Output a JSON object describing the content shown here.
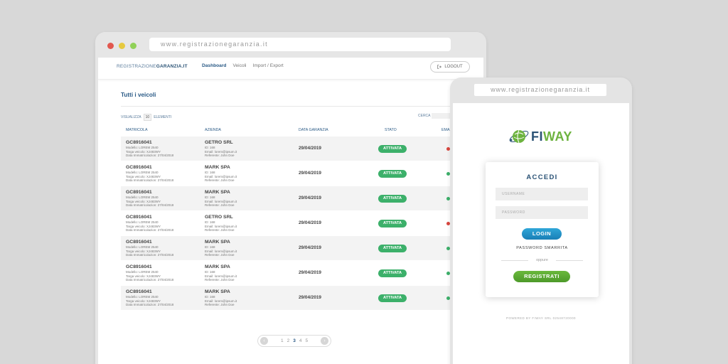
{
  "desktop": {
    "url": "www.registrazionegaranzia.it",
    "brand_light": "REGISTRAZIONE",
    "brand_bold": "GARANZIA.IT",
    "menu": [
      "Dashboard",
      "Veicoli",
      "Import / Export"
    ],
    "logout_label": "LOGOUT",
    "section_title": "Tutti i veicoli",
    "visualizza_label": "VISUALIZZA",
    "visualizza_value": "10",
    "elementi_label": "ELEMENTI",
    "cerca_label": "CERCA",
    "columns": [
      "MATRICOLA",
      "AZIENDA",
      "DATA GARANZIA",
      "STATO",
      "EMA"
    ],
    "rows": [
      {
        "code": "GC8916041",
        "modello": "Modello: LOREM 2540",
        "targa": "Targa veicolo: XJ483WY",
        "data_imm": "Data Immatricolazion: 27/04/2018",
        "azienda": "GETRO SRL",
        "id": "ID: 168",
        "email": "Email: lorem@ipsum.it",
        "referente": "Referente: John Doe",
        "data": "29/04/2019",
        "stato": "ATTIVATA",
        "ema": "red"
      },
      {
        "code": "GC8916041",
        "modello": "Modello: LOREM 2540",
        "targa": "Targa veicolo: XJ483WY",
        "data_imm": "Data Immatricolazion: 27/04/2018",
        "azienda": "MARK SPA",
        "id": "ID: 168",
        "email": "Email: lorem@ipsum.it",
        "referente": "Referente: John Doe",
        "data": "29/04/2019",
        "stato": "ATTIVATA",
        "ema": "green"
      },
      {
        "code": "GC8916041",
        "modello": "Modello: LOREM 2540",
        "targa": "Targa veicolo: XJ483WY",
        "data_imm": "Data Immatricolazion: 27/04/2018",
        "azienda": "MARK SPA",
        "id": "ID: 168",
        "email": "Email: lorem@ipsum.it",
        "referente": "Referente: John Doe",
        "data": "29/04/2019",
        "stato": "ATTIVATA",
        "ema": "green"
      },
      {
        "code": "GC8916041",
        "modello": "Modello: LOREM 2540",
        "targa": "Targa veicolo: XJ483WY",
        "data_imm": "Data Immatricolazion: 27/04/2018",
        "azienda": "GETRO SRL",
        "id": "ID: 168",
        "email": "Email: lorem@ipsum.it",
        "referente": "Referente: John Doe",
        "data": "29/04/2019",
        "stato": "ATTIVATA",
        "ema": "red"
      },
      {
        "code": "GC8916041",
        "modello": "Modello: LOREM 2540",
        "targa": "Targa veicolo: XJ483WY",
        "data_imm": "Data Immatricolazion: 27/04/2018",
        "azienda": "MARK SPA",
        "id": "ID: 168",
        "email": "Email: lorem@ipsum.it",
        "referente": "Referente: John Doe",
        "data": "29/04/2019",
        "stato": "ATTIVATA",
        "ema": "green"
      },
      {
        "code": "GC8916041",
        "modello": "Modello: LOREM 2540",
        "targa": "Targa veicolo: XJ483WY",
        "data_imm": "Data Immatricolazion: 27/04/2018",
        "azienda": "MARK SPA",
        "id": "ID: 168",
        "email": "Email: lorem@ipsum.it",
        "referente": "Referente: John Doe",
        "data": "29/04/2019",
        "stato": "ATTIVATA",
        "ema": "green"
      },
      {
        "code": "GC8916041",
        "modello": "Modello: LOREM 2540",
        "targa": "Targa veicolo: XJ483WY",
        "data_imm": "Data Immatricolazion: 27/04/2018",
        "azienda": "MARK SPA",
        "id": "ID: 168",
        "email": "Email: lorem@ipsum.it",
        "referente": "Referente: John Doe",
        "data": "29/04/2019",
        "stato": "ATTIVATA",
        "ema": "green"
      }
    ],
    "pages": [
      "1",
      "2",
      "3",
      "4",
      "5"
    ],
    "current_page": "3"
  },
  "mobile": {
    "url": "www.registrazionegaranzia.it",
    "logo_fi": "FI",
    "logo_way": "WAY",
    "card_title": "ACCEDI",
    "username_placeholder": "USERNAME",
    "password_placeholder": "PASSWORD",
    "login_label": "LOGIN",
    "forgot_label": "PASSWORD SMARRITA",
    "or_label": "oppure",
    "register_label": "REGISTRATI",
    "footer": "POWERED BY FIWAY SRL 02548720000"
  },
  "colors": {
    "status_green": "#3cb06a",
    "ema_red": "#d9463e",
    "ema_green": "#3cb06a",
    "brand_blue": "#2a5275",
    "brand_green": "#6db33f",
    "login_blue": "#1a8fc6",
    "register_green": "#5aa832"
  },
  "icons": [
    "window-close-dot",
    "window-minimize-dot",
    "window-maximize-dot",
    "logout-icon",
    "prev-arrow-icon",
    "next-arrow-icon",
    "fiway-globe-logo"
  ]
}
